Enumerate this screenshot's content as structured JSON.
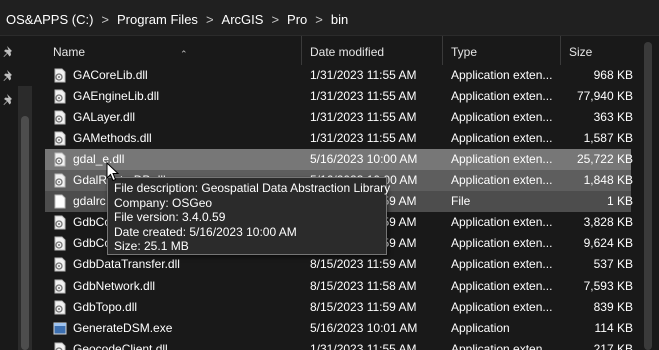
{
  "breadcrumb": {
    "parts": [
      "OS&APPS (C:)",
      "Program Files",
      "ArcGIS",
      "Pro",
      "bin"
    ],
    "separator": ">"
  },
  "columns": {
    "name": "Name",
    "date": "Date modified",
    "type": "Type",
    "size": "Size"
  },
  "files": [
    {
      "name": "GACoreLib.dll",
      "date": "1/31/2023 11:55 AM",
      "type": "Application exten...",
      "size": "968 KB",
      "icon": "dll-icon"
    },
    {
      "name": "GAEngineLib.dll",
      "date": "1/31/2023 11:55 AM",
      "type": "Application exten...",
      "size": "77,940 KB",
      "icon": "dll-icon"
    },
    {
      "name": "GALayer.dll",
      "date": "1/31/2023 11:55 AM",
      "type": "Application exten...",
      "size": "363 KB",
      "icon": "dll-icon"
    },
    {
      "name": "GAMethods.dll",
      "date": "1/31/2023 11:55 AM",
      "type": "Application exten...",
      "size": "1,587 KB",
      "icon": "dll-icon"
    },
    {
      "name": "gdal_e.dll",
      "date": "5/16/2023 10:00 AM",
      "type": "Application exten...",
      "size": "25,722 KB",
      "icon": "dll-icon"
    },
    {
      "name": "GdalRasterDB.dll",
      "date": "5/16/2023 10:00 AM",
      "type": "Application exten...",
      "size": "1,848 KB",
      "icon": "dll-icon"
    },
    {
      "name": "gdalrc",
      "date": "8/15/2023 11:59 AM",
      "type": "File",
      "size": "1 KB",
      "icon": "file-icon"
    },
    {
      "name": "GdbCoreLib.dll",
      "date": "8/15/2023 11:59 AM",
      "type": "Application exten...",
      "size": "3,828 KB",
      "icon": "dll-icon"
    },
    {
      "name": "GdbCoreLibEx.dll",
      "date": "8/15/2023 11:59 AM",
      "type": "Application exten...",
      "size": "9,624 KB",
      "icon": "dll-icon"
    },
    {
      "name": "GdbDataTransfer.dll",
      "date": "8/15/2023 11:59 AM",
      "type": "Application exten...",
      "size": "537 KB",
      "icon": "dll-icon"
    },
    {
      "name": "GdbNetwork.dll",
      "date": "8/15/2023 11:58 AM",
      "type": "Application exten...",
      "size": "7,593 KB",
      "icon": "dll-icon"
    },
    {
      "name": "GdbTopo.dll",
      "date": "8/15/2023 11:59 AM",
      "type": "Application exten...",
      "size": "839 KB",
      "icon": "dll-icon"
    },
    {
      "name": "GenerateDSM.exe",
      "date": "5/16/2023 10:01 AM",
      "type": "Application",
      "size": "114 KB",
      "icon": "exe-icon"
    },
    {
      "name": "GeocodeClient.dll",
      "date": "1/31/2023 11:55 AM",
      "type": "Application exten...",
      "size": "217 KB",
      "icon": "dll-icon"
    }
  ],
  "tooltip": {
    "description": "File description: Geospatial Data Abstraction Library",
    "company": "Company: OSGeo",
    "version": "File version: 3.4.0.59",
    "created": "Date created: 5/16/2023 10:00 AM",
    "size": "Size: 25.1 MB"
  },
  "icons": {
    "pin": "pin-icon",
    "dll": "dll-icon",
    "file": "file-icon",
    "exe": "exe-icon",
    "sort": "sort-up-icon",
    "cursor": "mouse-cursor-icon"
  }
}
